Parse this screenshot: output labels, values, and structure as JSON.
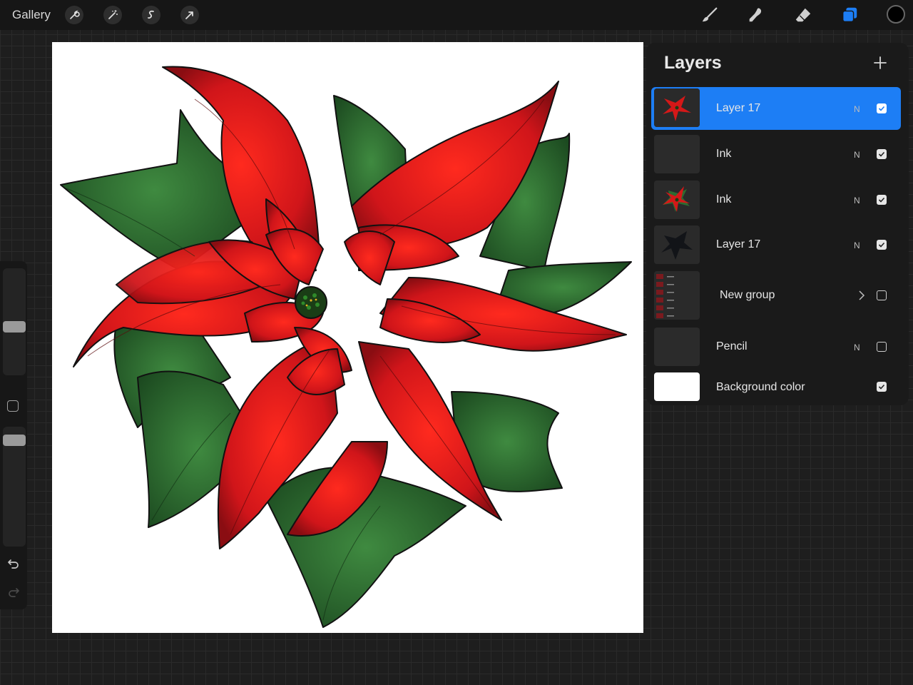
{
  "topbar": {
    "gallery_label": "Gallery",
    "left_tools": [
      "wrench-icon",
      "magic-wand-icon",
      "selection-icon",
      "transform-arrow-icon"
    ],
    "right_tools": [
      "brush-icon",
      "smudge-icon",
      "eraser-icon",
      "layers-icon"
    ],
    "active_color": "#000000",
    "accent_color": "#1d7ef5"
  },
  "sidebar": {
    "brush_size_level": 0.55,
    "opacity_level": 0.07
  },
  "layers_panel": {
    "title": "Layers",
    "layers": [
      {
        "name": "Layer 17",
        "blend": "N",
        "visible": true,
        "selected": true,
        "thumbnail": "poinsettia-thumbnail"
      },
      {
        "name": "Ink",
        "blend": "N",
        "visible": true,
        "selected": false,
        "thumbnail": "texture-thumbnail"
      },
      {
        "name": "Ink",
        "blend": "N",
        "visible": true,
        "selected": false,
        "thumbnail": "poinsettia-thumbnail"
      },
      {
        "name": "Layer 17",
        "blend": "N",
        "visible": true,
        "selected": false,
        "thumbnail": "silhouette-thumbnail"
      },
      {
        "name": "New group",
        "blend": "",
        "visible": false,
        "selected": false,
        "thumbnail": "group-thumbnail"
      },
      {
        "name": "Pencil",
        "blend": "N",
        "visible": false,
        "selected": false,
        "thumbnail": "texture-thumbnail"
      },
      {
        "name": "Background color",
        "blend": "",
        "visible": true,
        "selected": false,
        "thumbnail": "white-fill"
      }
    ]
  },
  "canvas": {
    "subject": "poinsettia",
    "colors": {
      "petal": "#d61a1a",
      "leaf": "#2e6b30",
      "center": "#1a3d16",
      "outline": "#111111"
    }
  }
}
